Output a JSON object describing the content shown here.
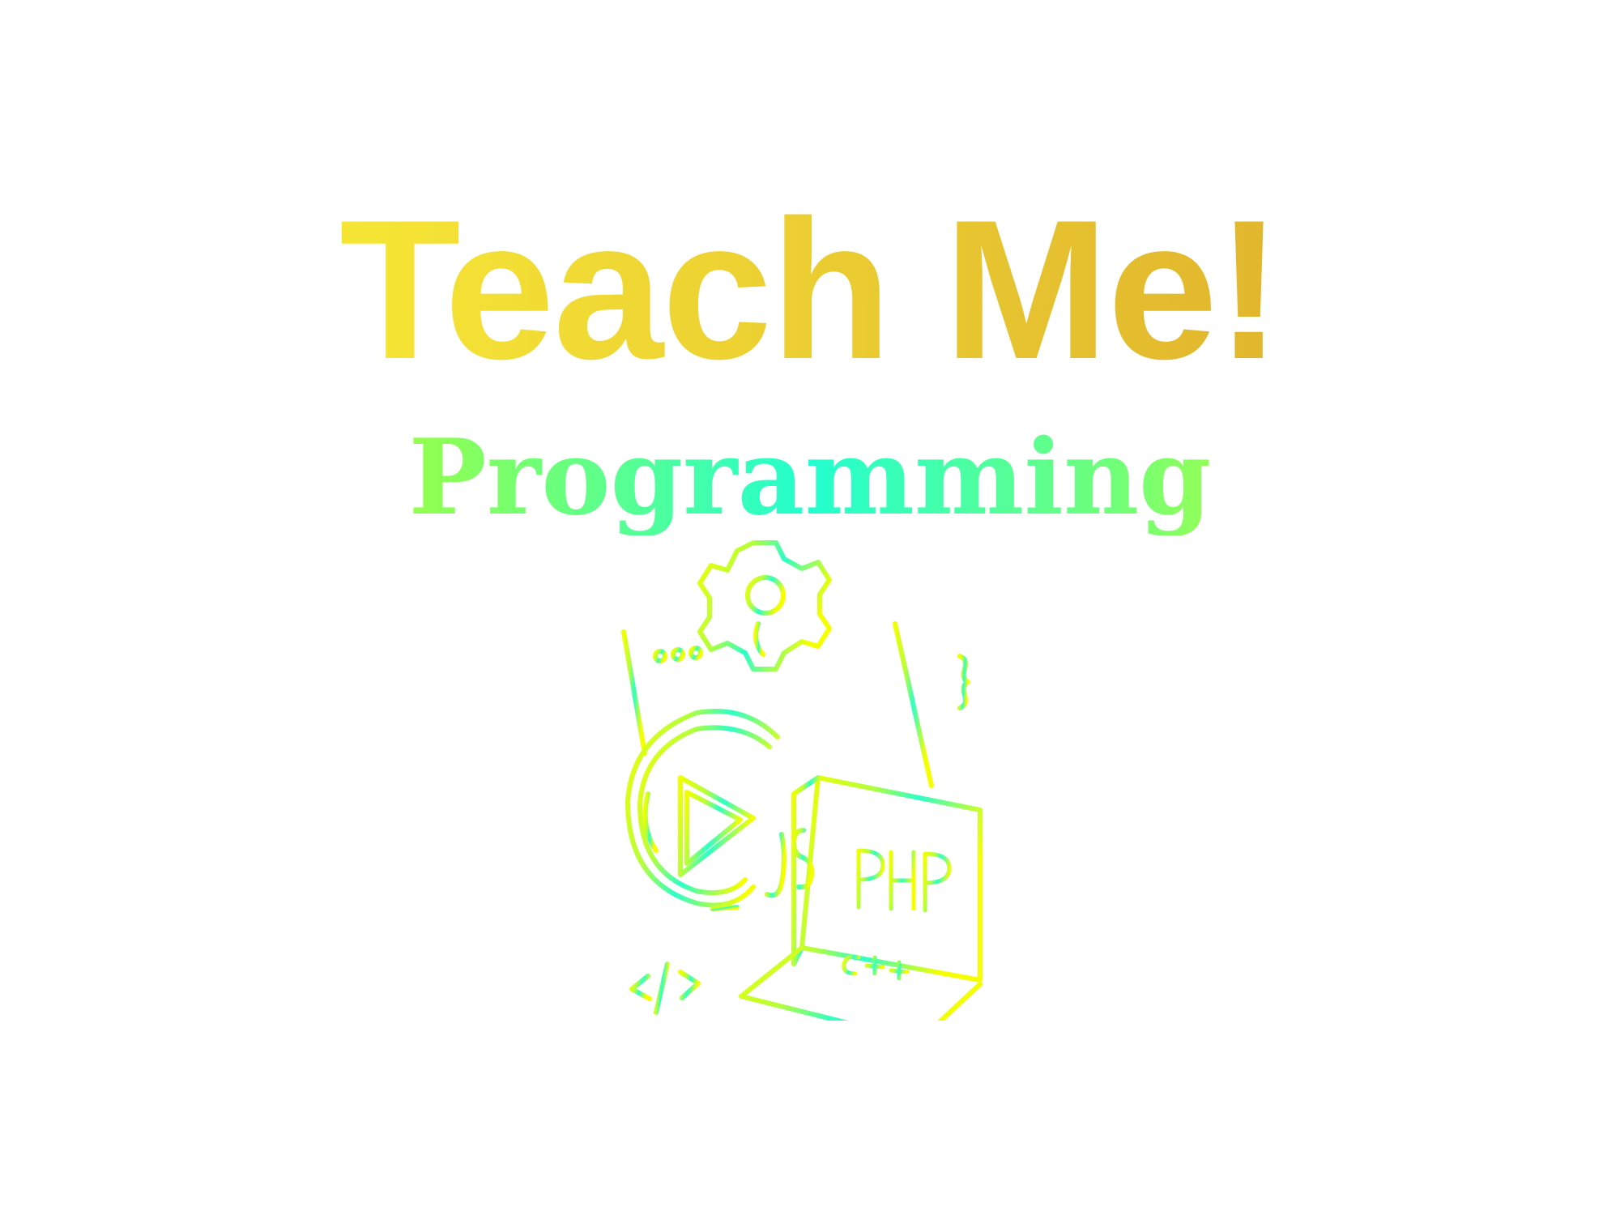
{
  "header": {
    "title": "Teach Me!",
    "subtitle": "Programming"
  },
  "illustration": {
    "icon": "programming-illustration-icon",
    "labels": {
      "php": "PHP",
      "cpp": "C++",
      "js": "JS",
      "tag": "</>"
    }
  },
  "colors": {
    "title_gradient": [
      "#fff533",
      "#dca52b"
    ],
    "subtitle_gradient": [
      "#f2ff00",
      "#22ffd0",
      "#f6ff00"
    ]
  }
}
